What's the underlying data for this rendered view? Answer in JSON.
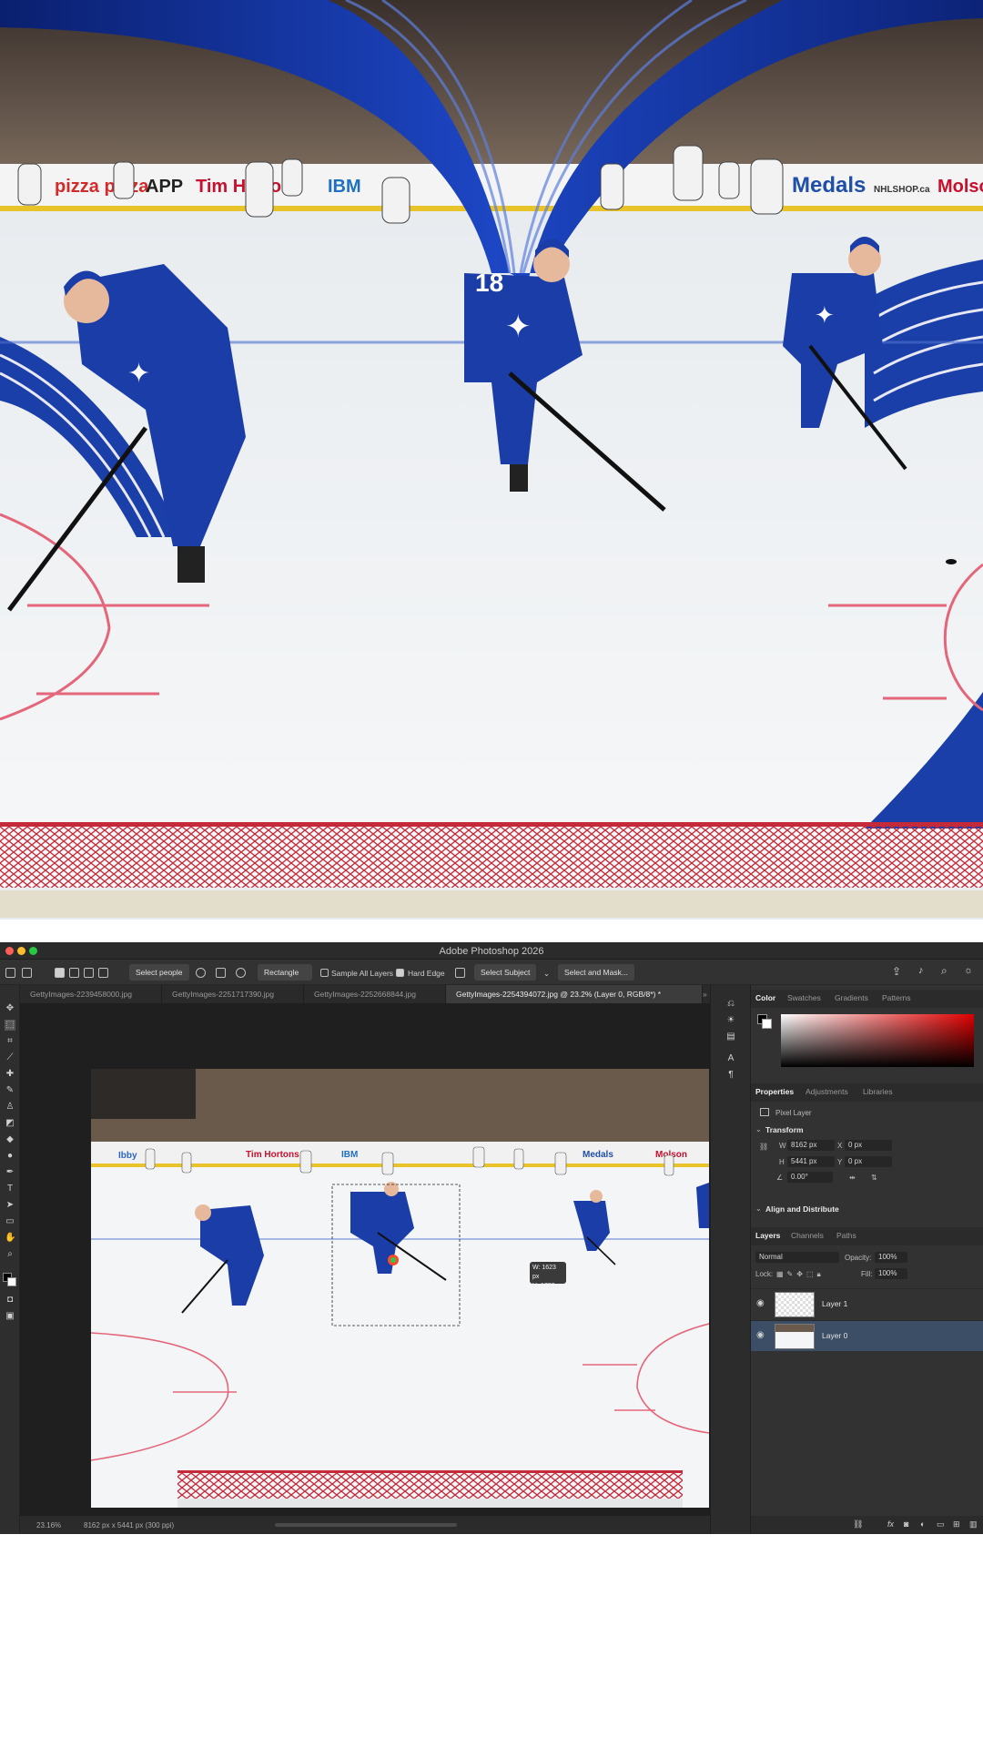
{
  "hero": {
    "ads": [
      "pizza pizza",
      "APP",
      "Tim Hortons",
      "IBM",
      "Medals",
      "NHLSHOP.ca",
      "Molson"
    ],
    "jersey_number_center": "18"
  },
  "photoshop": {
    "window_title": "Adobe Photoshop 2026",
    "options_bar": {
      "select_people": "Select people",
      "mode": "Rectangle",
      "sample_all_layers": "Sample All Layers",
      "hard_edge": "Hard Edge",
      "select_subject": "Select Subject",
      "select_and_mask": "Select and Mask..."
    },
    "tabs": [
      {
        "label": "GettyImages-2239458000.jpg",
        "active": false
      },
      {
        "label": "GettyImages-2251717390.jpg",
        "active": false
      },
      {
        "label": "GettyImages-2252668844.jpg",
        "active": false
      },
      {
        "label": "GettyImages-2254394072.jpg @ 23.2% (Layer 0, RGB/8*) *",
        "active": true
      }
    ],
    "selection_tooltip": {
      "w": "W: 1623 px",
      "h": "H: 1780 px"
    },
    "status": {
      "zoom": "23.16%",
      "doc_size": "8162 px x 5441 px (300 ppi)"
    },
    "color_panel": {
      "tabs": [
        "Color",
        "Swatches",
        "Gradients",
        "Patterns"
      ],
      "active_tab": "Color",
      "foreground": "#000000",
      "background": "#ffffff",
      "hue_color": "#e00000"
    },
    "properties_panel": {
      "tabs": [
        "Properties",
        "Adjustments",
        "Libraries"
      ],
      "active_tab": "Properties",
      "layer_type": "Pixel Layer",
      "transform_title": "Transform",
      "w_label": "W",
      "w_value": "8162 px",
      "x_label": "X",
      "x_value": "0 px",
      "h_label": "H",
      "h_value": "5441 px",
      "y_label": "Y",
      "y_value": "0 px",
      "angle": "0.00°",
      "align_title": "Align and Distribute"
    },
    "layers_panel": {
      "tabs": [
        "Layers",
        "Channels",
        "Paths"
      ],
      "active_tab": "Layers",
      "blend_mode": "Normal",
      "opacity_label": "Opacity:",
      "opacity_value": "100%",
      "lock_label": "Lock:",
      "fill_label": "Fill:",
      "fill_value": "100%",
      "layers": [
        {
          "name": "Layer 1",
          "selected": false
        },
        {
          "name": "Layer 0",
          "selected": true
        }
      ]
    },
    "accent_selected_row": "#3b4e66"
  }
}
